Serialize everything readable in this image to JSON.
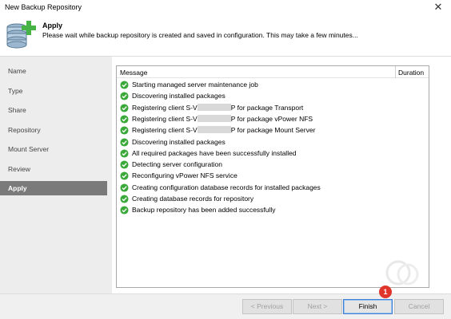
{
  "window": {
    "title": "New Backup Repository"
  },
  "header": {
    "title": "Apply",
    "subtitle": "Please wait while backup repository is created and saved in configuration. This may take a few minutes..."
  },
  "sidebar": {
    "items": [
      {
        "label": "Name",
        "active": false
      },
      {
        "label": "Type",
        "active": false
      },
      {
        "label": "Share",
        "active": false
      },
      {
        "label": "Repository",
        "active": false
      },
      {
        "label": "Mount Server",
        "active": false
      },
      {
        "label": "Review",
        "active": false
      },
      {
        "label": "Apply",
        "active": true
      }
    ]
  },
  "log": {
    "columns": {
      "message": "Message",
      "duration": "Duration"
    },
    "rows": [
      {
        "status": "success",
        "prefix": "Starting managed server maintenance job"
      },
      {
        "status": "success",
        "prefix": "Discovering installed packages"
      },
      {
        "status": "success",
        "prefix": "Registering client S-V",
        "redacted": true,
        "suffix": "P for package Transport"
      },
      {
        "status": "success",
        "prefix": "Registering client S-V",
        "redacted": true,
        "suffix": "P for package vPower NFS"
      },
      {
        "status": "success",
        "prefix": "Registering client S-V",
        "redacted": true,
        "suffix": "P for package Mount Server"
      },
      {
        "status": "success",
        "prefix": "Discovering installed packages"
      },
      {
        "status": "success",
        "prefix": "All required packages have been successfully installed"
      },
      {
        "status": "success",
        "prefix": "Detecting server configuration"
      },
      {
        "status": "success",
        "prefix": "Reconfiguring vPower NFS service"
      },
      {
        "status": "success",
        "prefix": "Creating configuration database records for installed packages"
      },
      {
        "status": "success",
        "prefix": "Creating database records for repository"
      },
      {
        "status": "success",
        "prefix": "Backup repository has been added successfully"
      }
    ]
  },
  "footer": {
    "previous_label": "< Previous",
    "next_label": "Next >",
    "finish_label": "Finish",
    "cancel_label": "Cancel",
    "badge": "1"
  },
  "colors": {
    "success": "#3aa93a",
    "accent": "#3c7fd4",
    "badge": "#e0352b",
    "active_nav": "#7a7a7a"
  },
  "icons": {
    "header": "database-add-icon",
    "row": "check-circle-icon",
    "close": "close-icon"
  }
}
